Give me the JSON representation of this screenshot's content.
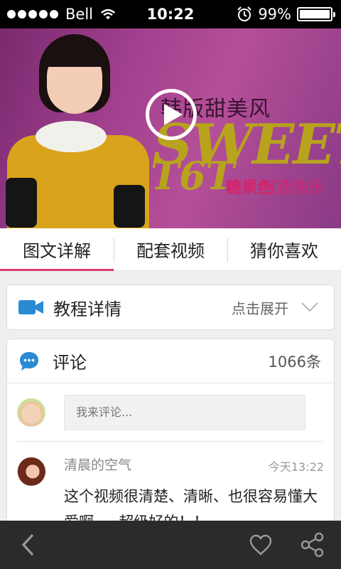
{
  "status_bar": {
    "carrier": "Bell",
    "time": "10:22",
    "battery": "99%",
    "battery_level": 0.99
  },
  "banner": {
    "title_cn": "韩版甜美风",
    "line1": "SWEET",
    "line2": "T6T",
    "brand": "糖果色",
    "slogan": "打造快乐"
  },
  "tabs": [
    {
      "label": "图文详解"
    },
    {
      "label": "配套视频"
    },
    {
      "label": "猜你喜欢"
    }
  ],
  "tutorial_card": {
    "title": "教程详情",
    "expand_label": "点击展开"
  },
  "comments": {
    "title": "评论",
    "count": "1066条",
    "input_placeholder": "我来评论...",
    "items": [
      {
        "user": "清晨的空气",
        "time": "今天13:22",
        "text": "这个视频很清楚、清晰、也很容易懂大爱啊~~超级好的！！"
      }
    ]
  },
  "colors": {
    "accent": "#e03a71",
    "icon_blue": "#2a8ad4",
    "bottom_bar": "#2b2b2b"
  },
  "icons": {
    "back": "back-arrow-icon",
    "favorite": "heart-icon",
    "share": "share-icon"
  }
}
